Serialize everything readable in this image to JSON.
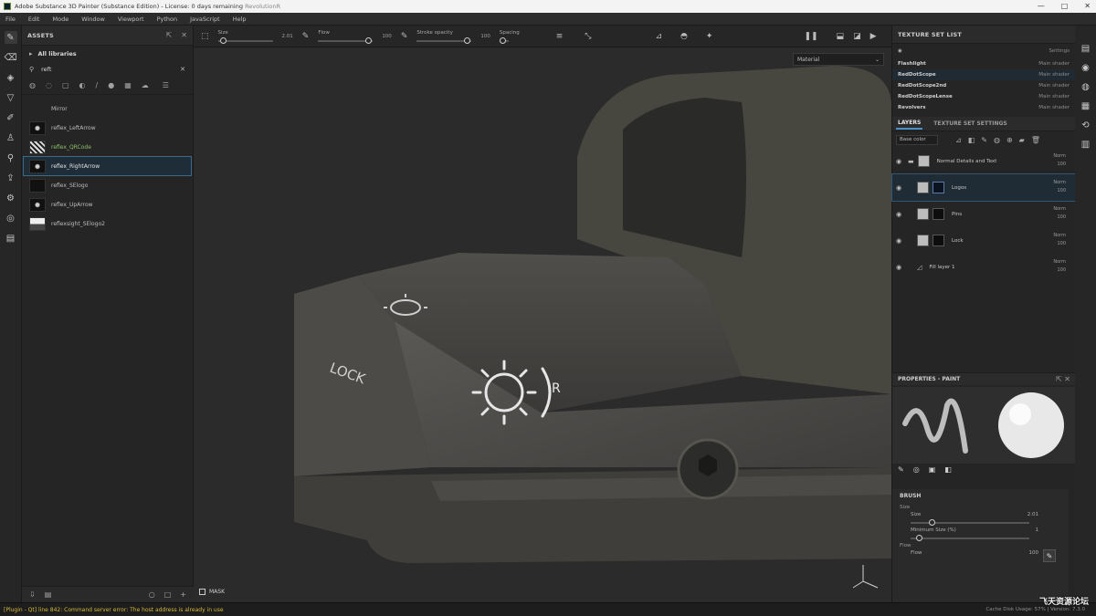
{
  "window": {
    "title": "Adobe Substance 3D Painter (Substance Edition) - License: 0 days remaining",
    "version": "RevolutionR",
    "controls": [
      "—",
      "□",
      "✕"
    ]
  },
  "menu": [
    "File",
    "Edit",
    "Mode",
    "Window",
    "Viewport",
    "Python",
    "JavaScript",
    "Help"
  ],
  "assets": {
    "title": "ASSETS",
    "library": "All libraries",
    "search_value": "reft",
    "items": [
      {
        "name": "Mirror",
        "thumb": "none",
        "highlight": false,
        "selected": false
      },
      {
        "name": "reflex_LeftArrow",
        "thumb": "cross",
        "highlight": false,
        "selected": false
      },
      {
        "name": "reflex_QRCode",
        "thumb": "qr",
        "highlight": true,
        "selected": false
      },
      {
        "name": "reflex_RightArrow",
        "thumb": "cross",
        "highlight": false,
        "selected": true
      },
      {
        "name": "reflex_SElogo",
        "thumb": "dark",
        "highlight": false,
        "selected": false
      },
      {
        "name": "reflex_UpArrow",
        "thumb": "cross",
        "highlight": false,
        "selected": false
      },
      {
        "name": "reflexsight_SElogo2",
        "thumb": "light",
        "highlight": false,
        "selected": false
      }
    ]
  },
  "toolbar": {
    "size_label": "Size",
    "size_value": "2.01",
    "flow_label": "Flow",
    "flow_value": "100",
    "stroke_opacity_label": "Stroke opacity",
    "stroke_opacity_value": "100",
    "spacing_label": "Spacing",
    "material_mode": "Material"
  },
  "viewport": {
    "mask_label": "MASK",
    "decal_lock_text": "LOCK",
    "decal_r_text": "R"
  },
  "texture_set_list": {
    "title": "TEXTURE SET LIST",
    "settings_label": "Settings",
    "sets": [
      {
        "name": "Flashlight",
        "shader": "Main shader",
        "selected": false
      },
      {
        "name": "RedDotScope",
        "shader": "Main shader",
        "selected": true
      },
      {
        "name": "RedDotScope2nd",
        "shader": "Main shader",
        "selected": false
      },
      {
        "name": "RedDotScopeLense",
        "shader": "Main shader",
        "selected": false
      },
      {
        "name": "Revolvers",
        "shader": "Main shader",
        "selected": false
      }
    ]
  },
  "layers_panel": {
    "tabs": [
      "LAYERS",
      "TEXTURE SET SETTINGS"
    ],
    "view_select": "Base color",
    "layers": [
      {
        "name": "Normal Details and Text",
        "blend": "Norm",
        "opacity": "100",
        "thumb": "light",
        "mask": "none",
        "selected": false
      },
      {
        "name": "Logos",
        "blend": "Norm",
        "opacity": "100",
        "thumb": "light",
        "mask": "blue",
        "selected": true
      },
      {
        "name": "Pins",
        "blend": "Norm",
        "opacity": "100",
        "thumb": "light",
        "mask": "dark",
        "selected": false
      },
      {
        "name": "Lock",
        "blend": "Norm",
        "opacity": "100",
        "thumb": "light",
        "mask": "dark",
        "selected": false
      },
      {
        "name": "Fill layer 1",
        "blend": "Norm",
        "opacity": "100",
        "thumb": "fill",
        "mask": "none",
        "selected": false
      }
    ]
  },
  "properties": {
    "title": "PROPERTIES - PAINT",
    "brush_section": "BRUSH",
    "size_group": "Size",
    "size_label": "Size",
    "size_value": "2.01",
    "min_size_label": "Minimum Size (%)",
    "min_size_value": "1",
    "flow_group": "Flow",
    "flow_label": "Flow",
    "flow_value": "100"
  },
  "status": {
    "error": "[Plugin - Qt] line 842: Command server error: The host address is already in use",
    "cache": "Cache Disk Usage: 57% | Version: 7.3.0"
  },
  "watermark": "飞天资源论坛"
}
